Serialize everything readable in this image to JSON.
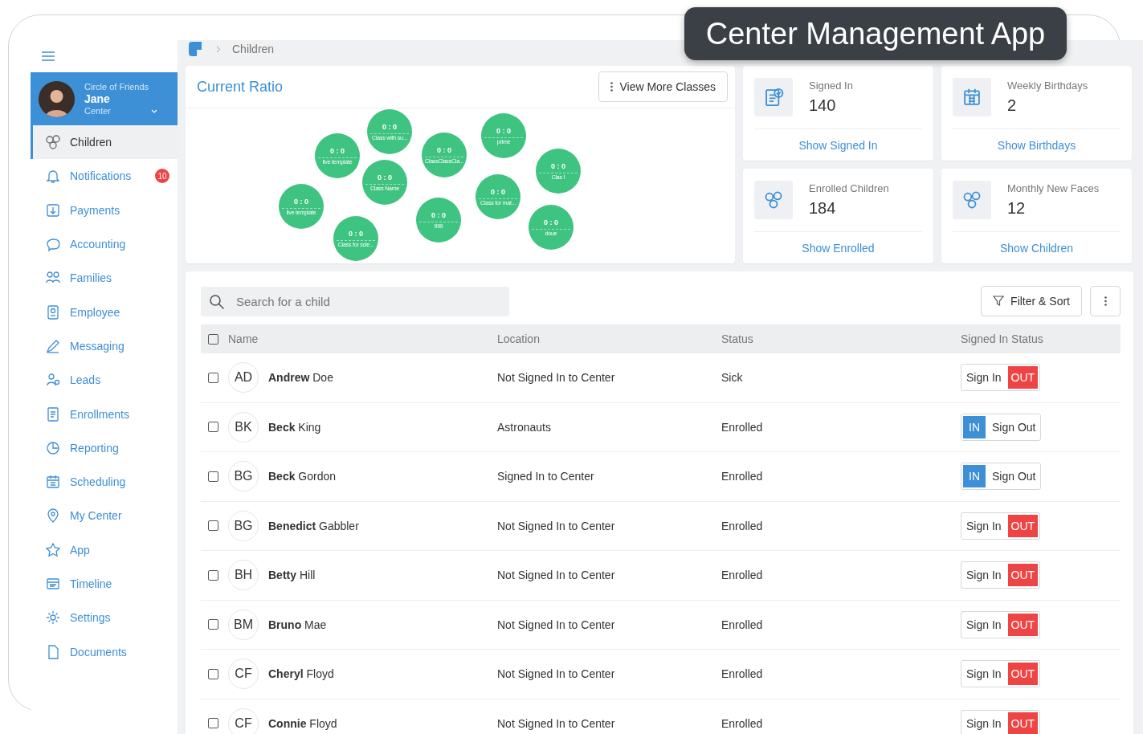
{
  "banner": {
    "title": "Center Management App"
  },
  "profile": {
    "organization": "Circle of Friends",
    "name": "Jane",
    "role": "Center"
  },
  "sidebar": {
    "items": [
      {
        "label": "Children",
        "selected": true
      },
      {
        "label": "Notifications",
        "selected": false,
        "badge": "10"
      },
      {
        "label": "Payments",
        "selected": false
      },
      {
        "label": "Accounting",
        "selected": false
      },
      {
        "label": "Families",
        "selected": false
      },
      {
        "label": "Employee",
        "selected": false
      },
      {
        "label": "Messaging",
        "selected": false
      },
      {
        "label": "Leads",
        "selected": false
      },
      {
        "label": "Enrollments",
        "selected": false
      },
      {
        "label": "Reporting",
        "selected": false
      },
      {
        "label": "Scheduling",
        "selected": false
      },
      {
        "label": "My Center",
        "selected": false
      },
      {
        "label": "App",
        "selected": false
      },
      {
        "label": "Timeline",
        "selected": false
      },
      {
        "label": "Settings",
        "selected": false
      },
      {
        "label": "Documents",
        "selected": false
      }
    ]
  },
  "breadcrumb": {
    "current": "Children"
  },
  "ratio": {
    "title": "Current Ratio",
    "button": "View More Classes",
    "classes": [
      {
        "ratio": "0 : 0",
        "name": "Class with su..."
      },
      {
        "ratio": "0 : 0",
        "name": "prime"
      },
      {
        "ratio": "0 : 0",
        "name": "live template"
      },
      {
        "ratio": "0 : 0",
        "name": "ClassClassCla..."
      },
      {
        "ratio": "0 : 0",
        "name": "Clas I"
      },
      {
        "ratio": "0 : 0",
        "name": "Class Name"
      },
      {
        "ratio": "0 : 0",
        "name": "Class for mat..."
      },
      {
        "ratio": "0 : 0",
        "name": "live template"
      },
      {
        "ratio": "0 : 0",
        "name": "999"
      },
      {
        "ratio": "0 : 0",
        "name": "doue"
      },
      {
        "ratio": "0 : 0",
        "name": "Class for scie..."
      }
    ]
  },
  "stats": [
    {
      "kind": "clipboard",
      "label": "Signed In",
      "value": "140",
      "link": "Show Signed In"
    },
    {
      "kind": "calendar",
      "label": "Weekly Birthdays",
      "value": "2",
      "link": "Show Birthdays"
    },
    {
      "kind": "faces",
      "label": "Enrolled Children",
      "value": "184",
      "link": "Show Enrolled"
    },
    {
      "kind": "faces",
      "label": "Monthly New Faces",
      "value": "12",
      "link": "Show Children"
    }
  ],
  "table": {
    "search_placeholder": "Search for a child",
    "filter_button": "Filter & Sort",
    "select_all_checked": false,
    "columns": [
      "Name",
      "Location",
      "Status",
      "Signed In Status"
    ],
    "rows": [
      {
        "initials": "AD",
        "name": "**Andrew** Doe",
        "location": "Not Signed In to Center",
        "status": "Sick",
        "signed_in": false,
        "badge": "OUT",
        "action": "Sign In",
        "checked": false
      },
      {
        "initials": "BK",
        "name": "**Beck** King",
        "location": "Astronauts",
        "status": "Enrolled",
        "signed_in": true,
        "badge": "IN",
        "action": "Sign Out",
        "checked": false
      },
      {
        "initials": "BG",
        "name": "**Beck** Gordon",
        "location": "Signed In to Center",
        "status": "Enrolled",
        "signed_in": true,
        "badge": "IN",
        "action": "Sign Out",
        "checked": false
      },
      {
        "initials": "BG",
        "name": "**Benedict** Gabbler",
        "location": "Not Signed In to Center",
        "status": "Enrolled",
        "signed_in": false,
        "badge": "OUT",
        "action": "Sign In",
        "checked": false
      },
      {
        "initials": "BH",
        "name": "**Betty** Hill",
        "location": "Not Signed In to Center",
        "status": "Enrolled",
        "signed_in": false,
        "badge": "OUT",
        "action": "Sign In",
        "checked": false
      },
      {
        "initials": "BM",
        "name": "**Bruno** Mae",
        "location": "Not Signed In to Center",
        "status": "Enrolled",
        "signed_in": false,
        "badge": "OUT",
        "action": "Sign In",
        "checked": false
      },
      {
        "initials": "CF",
        "name": "**Cheryl** Floyd",
        "location": "Not Signed In to Center",
        "status": "Enrolled",
        "signed_in": false,
        "badge": "OUT",
        "action": "Sign In",
        "checked": false
      },
      {
        "initials": "CF",
        "name": "**Connie** Floyd",
        "location": "Not Signed In to Center",
        "status": "Enrolled",
        "signed_in": false,
        "badge": "OUT",
        "action": "Sign In",
        "checked": false
      }
    ]
  }
}
